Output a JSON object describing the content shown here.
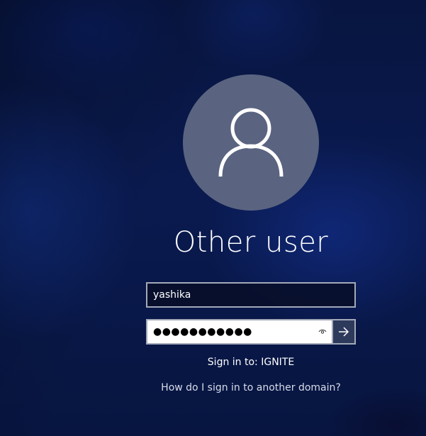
{
  "user": {
    "display_name": "Other user"
  },
  "form": {
    "username_value": "yashika",
    "password_mask": "●●●●●●●●●●●",
    "sign_in_to_label": "Sign in to: IGNITE",
    "help_link_label": "How do I sign in to another domain?"
  },
  "icons": {
    "avatar": "user-silhouette-icon",
    "reveal": "eye-icon",
    "submit": "arrow-right-icon"
  },
  "colors": {
    "avatar_bg": "#5a6480",
    "field_border": "#a3a9b8",
    "submit_bg": "#2e3a5c",
    "text": "#ffffff"
  }
}
